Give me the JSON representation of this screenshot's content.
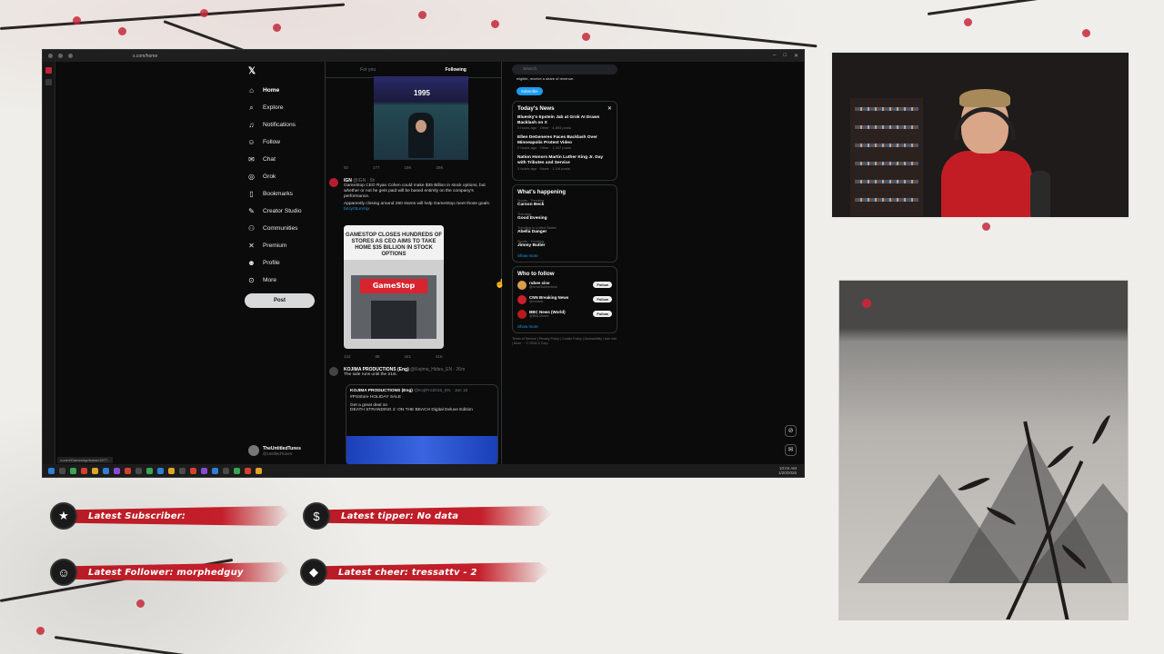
{
  "browser": {
    "url": "x.com/home",
    "status_url": "x.com/Gamestop/status/1877..."
  },
  "x_nav": {
    "items": [
      {
        "label": "Home",
        "icon": "home-icon"
      },
      {
        "label": "Explore",
        "icon": "search-icon"
      },
      {
        "label": "Notifications",
        "icon": "bell-icon"
      },
      {
        "label": "Follow",
        "icon": "person-icon"
      },
      {
        "label": "Chat",
        "icon": "chat-icon"
      },
      {
        "label": "Grok",
        "icon": "grok-icon"
      },
      {
        "label": "Bookmarks",
        "icon": "bookmark-icon"
      },
      {
        "label": "Creator Studio",
        "icon": "creator-icon"
      },
      {
        "label": "Communities",
        "icon": "communities-icon"
      },
      {
        "label": "Premium",
        "icon": "x-icon"
      },
      {
        "label": "Profile",
        "icon": "profile-icon"
      },
      {
        "label": "More",
        "icon": "more-icon"
      }
    ],
    "post_label": "Post",
    "profile_name": "TheUntitledTunes",
    "profile_handle": "@UntitledTunes"
  },
  "feed": {
    "tab_for_you": "For you",
    "tab_following": "Following",
    "media1_year": "1995",
    "tweet1_actions": [
      "92",
      "177",
      "18K",
      "28K"
    ],
    "tweet2": {
      "name": "IGN",
      "handle": "@IGN · 5h",
      "text": "GameStop CEO Ryan Cohen could make $35 Billion in stock options, but whether or not he gets paid will be based entirely on the company's performance.",
      "text2": "Apparently closing around 260 stores will help GameStop meet those goals.",
      "link": "bit.ly/3LeVnjx",
      "image_headline": "GAMESTOP CLOSES HUNDREDS OF STORES AS CEO AIMS TO TAKE HOME $35 BILLION IN STOCK OPTIONS",
      "store_sign": "GameStop",
      "actions": [
        "122",
        "88",
        "441",
        "41K"
      ]
    },
    "tweet3": {
      "name": "KOJIMA PRODUCTIONS (Eng)",
      "handle": "@Kojima_Hideo_EN · 26m",
      "text": "The sale runs until the 21st.",
      "quote_name": "KOJIMA PRODUCTIONS (Eng)",
      "quote_handle": "@KojiPro2015_EN · Jan 16",
      "quote_text1": "#PSStore HOLIDAY SALE",
      "quote_text2": "Get a great deal on",
      "quote_text3": "DEATH STRANDING 2: ON THE BEACH Digital Deluxe Edition"
    }
  },
  "right": {
    "search_placeholder": "Search",
    "subscribe_text": "eligible, receive a share of revenue.",
    "subscribe_button": "Subscribe",
    "news_title": "Today's News",
    "news": [
      {
        "title": "Bluesky's Epstein Jab at Grok AI Draws Backlash on X",
        "meta": "3 hours ago · Other · 4,893 posts"
      },
      {
        "title": "Ellen DeGeneres Faces Backlash Over Minneapolis Protest Video",
        "meta": "2 hours ago · Other · 1,347 posts"
      },
      {
        "title": "Nation Honors Martin Luther King Jr. Day with Tributes and Service",
        "meta": "3 hours ago · News · 1.1M posts"
      }
    ],
    "happening_title": "What's happening",
    "trends": [
      {
        "context": "Sports · Trending",
        "name": "Carson Beck"
      },
      {
        "context": "Trending",
        "name": "Good Evening"
      },
      {
        "context": "Trending in United States",
        "name": "Abella Danger"
      },
      {
        "context": "Sports · Trending",
        "name": "Jimmy Butler"
      }
    ],
    "show_more": "Show more",
    "wtf_title": "Who to follow",
    "wtf": [
      {
        "name": "rubee sins",
        "handle": "@rrrssRubbersins",
        "color": "#d9a04a"
      },
      {
        "name": "CNN Breaking News",
        "handle": "@cnnbrk",
        "color": "#cc1f2a"
      },
      {
        "name": "BBC News (World)",
        "handle": "@BBCWorld",
        "color": "#bb1919"
      }
    ],
    "follow_label": "Follow",
    "show_more2": "Show more",
    "footer": "Terms of Service | Privacy Policy | Cookie Policy | Accessibility | Ads info | More ··· © 2026 X Corp."
  },
  "taskbar": {
    "time": "10:04 AM",
    "date": "1/20/2026"
  },
  "alerts": {
    "subscriber": "Latest Subscriber:",
    "tipper": "Latest tipper: No data",
    "follower": "Latest Follower: morphedguy",
    "cheer": "Latest cheer: tressattv - 2"
  },
  "colors": {
    "accent_red": "#c41f2a",
    "x_blue": "#1d9bf0",
    "x_bg": "#0b0b0b"
  }
}
